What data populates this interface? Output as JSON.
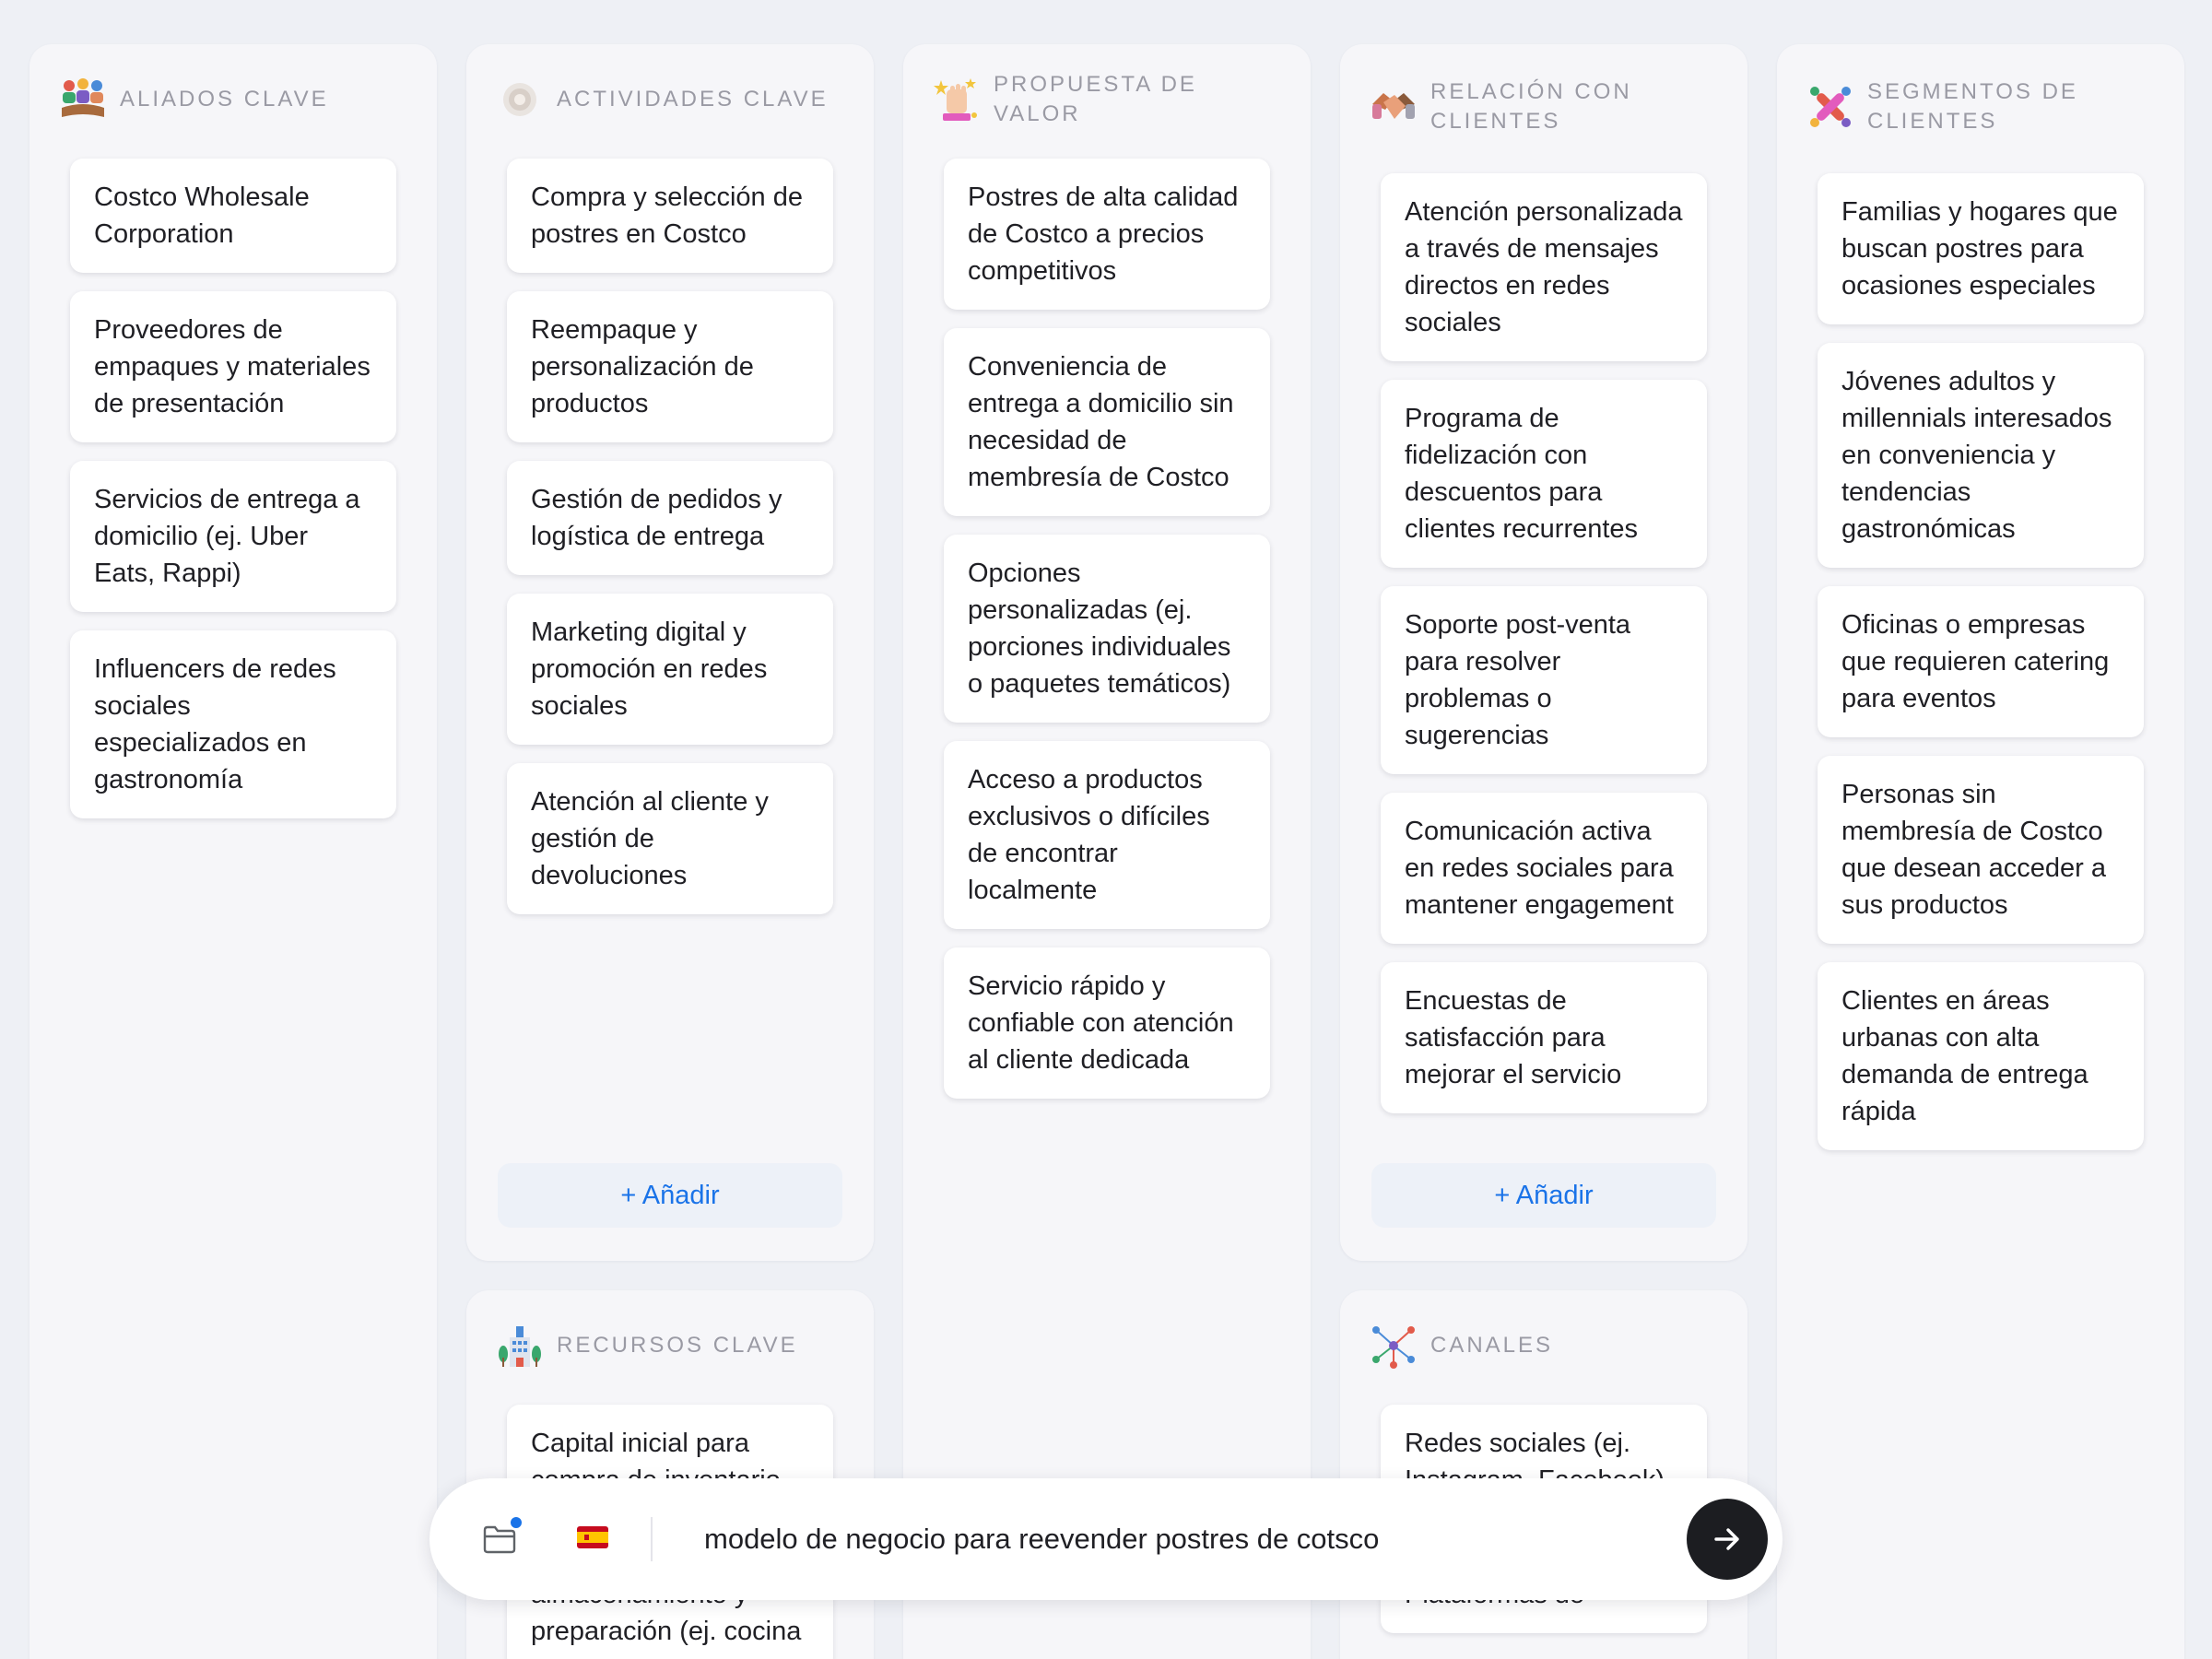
{
  "columns": {
    "aliados": {
      "title": "ALIADOS CLAVE",
      "icon": "handshake-people-icon",
      "cards": [
        "Costco Wholesale Corporation",
        "Proveedores de empaques y materiales de presentación",
        "Servicios de entrega a domicilio (ej. Uber Eats, Rappi)",
        "Influencers de redes sociales especializados en gastronomía"
      ]
    },
    "actividades": {
      "title": "ACTIVIDADES CLAVE",
      "icon": "gear-icon",
      "cards": [
        "Compra y selección de postres en Costco",
        "Reempaque y personalización de productos",
        "Gestión de pedidos y logística de entrega",
        "Marketing digital y promoción en redes sociales",
        "Atención al cliente y gestión de devoluciones"
      ],
      "add_label": "+ Añadir"
    },
    "recursos": {
      "title": "RECURSOS CLAVE",
      "icon": "building-icon",
      "cards": [
        "Capital inicial para compra de inventario",
        "almacenamiento y preparación (ej. cocina"
      ]
    },
    "propuesta": {
      "title": "PROPUESTA DE VALOR",
      "icon": "gift-stars-icon",
      "cards": [
        "Postres de alta calidad de Costco a precios competitivos",
        "Conveniencia de entrega a domicilio sin necesidad de membresía de Costco",
        "Opciones personalizadas (ej. porciones individuales o paquetes temáticos)",
        "Acceso a productos exclusivos o difíciles de encontrar localmente",
        "Servicio rápido y confiable con atención al cliente dedicada"
      ]
    },
    "relacion": {
      "title": "RELACIÓN CON CLIENTES",
      "icon": "handshake-icon",
      "cards": [
        "Atención personalizada a través de mensajes directos en redes sociales",
        "Programa de fidelización con descuentos para clientes recurrentes",
        "Soporte post-venta para resolver problemas o sugerencias",
        "Comunicación activa en redes sociales para mantener engagement",
        "Encuestas de satisfacción para mejorar el servicio"
      ],
      "add_label": "+ Añadir"
    },
    "canales": {
      "title": "CANALES",
      "icon": "network-icon",
      "cards": [
        "Redes sociales (ej. Instagram, Facebook)",
        "Plataformas de"
      ]
    },
    "segmentos": {
      "title": "SEGMENTOS DE CLIENTES",
      "icon": "puzzle-people-icon",
      "cards": [
        "Familias y hogares que buscan postres para ocasiones especiales",
        "Jóvenes adultos y millennials interesados en conveniencia y tendencias gastronómicas",
        "Oficinas o empresas que requieren catering para eventos",
        "Personas sin membresía de Costco que desean acceder a sus productos",
        "Clientes en áreas urbanas con alta demanda de entrega rápida"
      ]
    }
  },
  "chatbar": {
    "input_text": "modelo de negocio para reevender postres de cotsco",
    "folder_icon": "folder-icon",
    "flag_icon": "spain-flag-icon",
    "send_icon": "arrow-right-icon"
  },
  "colors": {
    "accent": "#1a73e8",
    "send_button": "#1c1d21",
    "background": "#eef0f5"
  }
}
